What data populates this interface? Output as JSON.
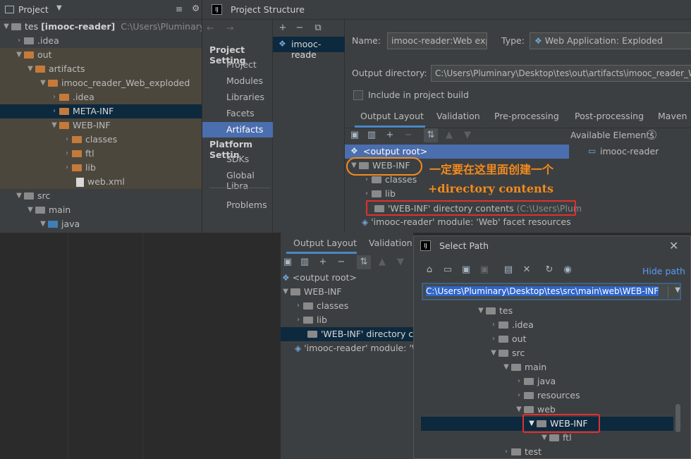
{
  "project_panel": {
    "title": "Project",
    "root": {
      "name": "tes",
      "module": "[imooc-reader]",
      "path": "C:\\Users\\Pluminary\\De"
    },
    "items": [
      {
        "label": ".idea",
        "depth": 1
      },
      {
        "label": "out",
        "depth": 1
      },
      {
        "label": "artifacts",
        "depth": 2
      },
      {
        "label": "imooc_reader_Web_exploded",
        "depth": 3
      },
      {
        "label": ".idea",
        "depth": 4
      },
      {
        "label": "META-INF",
        "depth": 4
      },
      {
        "label": "WEB-INF",
        "depth": 4
      },
      {
        "label": "classes",
        "depth": 5
      },
      {
        "label": "ftl",
        "depth": 5
      },
      {
        "label": "lib",
        "depth": 5
      },
      {
        "label": "web.xml",
        "depth": 5
      },
      {
        "label": "src",
        "depth": 1
      },
      {
        "label": "main",
        "depth": 2
      },
      {
        "label": "java",
        "depth": 3
      }
    ]
  },
  "project_structure": {
    "title": "Project Structure",
    "nav": {
      "project_settings": "Project Setting",
      "items": [
        "Project",
        "Modules",
        "Libraries",
        "Facets",
        "Artifacts"
      ],
      "platform_settings": "Platform Settin",
      "platform_items": [
        "SDKs",
        "Global Libra"
      ],
      "problems": "Problems"
    },
    "artifact_item": "imooc-reade",
    "name_label": "Name:",
    "name_value": "imooc-reader:Web exp",
    "type_label": "Type:",
    "type_value": "Web Application: Exploded",
    "output_dir_label": "Output directory:",
    "output_dir_value": "C:\\Users\\Pluminary\\Desktop\\tes\\out\\artifacts\\imooc_reader_W",
    "include_label": "Include in project build",
    "tabs": [
      "Output Layout",
      "Validation",
      "Pre-processing",
      "Post-processing",
      "Maven"
    ],
    "available_elements": "Available Elements",
    "available_item": "imooc-reader",
    "layout": {
      "root": "<output root>",
      "webinf": "WEB-INF",
      "classes": "classes",
      "lib": "lib",
      "dir_contents": "'WEB-INF' directory contents",
      "dir_contents_path": "(C:\\Users\\Plum",
      "facet": "'imooc-reader' module: 'Web' facet resources"
    },
    "annotation_line1": "一定要在这里面创建一个",
    "annotation_line2": "+directory contents"
  },
  "lower_layout": {
    "tabs": [
      "Output Layout",
      "Validation"
    ],
    "root": "<output root>",
    "webinf": "WEB-INF",
    "classes": "classes",
    "lib": "lib",
    "dir_contents": "'WEB-INF' directory co",
    "facet": "'imooc-reader' module: 'W"
  },
  "select_path": {
    "title": "Select Path",
    "hide_path": "Hide path",
    "path_value": "C:\\Users\\Pluminary\\Desktop\\tes\\src\\main\\web\\WEB-INF",
    "tree": [
      {
        "label": "tes",
        "depth": 0,
        "open": true
      },
      {
        "label": ".idea",
        "depth": 1,
        "open": false
      },
      {
        "label": "out",
        "depth": 1,
        "open": false
      },
      {
        "label": "src",
        "depth": 1,
        "open": true
      },
      {
        "label": "main",
        "depth": 2,
        "open": true
      },
      {
        "label": "java",
        "depth": 3,
        "open": false
      },
      {
        "label": "resources",
        "depth": 3,
        "open": false
      },
      {
        "label": "web",
        "depth": 3,
        "open": true
      },
      {
        "label": "WEB-INF",
        "depth": 4,
        "open": true
      },
      {
        "label": "ftl",
        "depth": 5,
        "open": true
      },
      {
        "label": "test",
        "depth": 2,
        "open": false
      }
    ]
  }
}
